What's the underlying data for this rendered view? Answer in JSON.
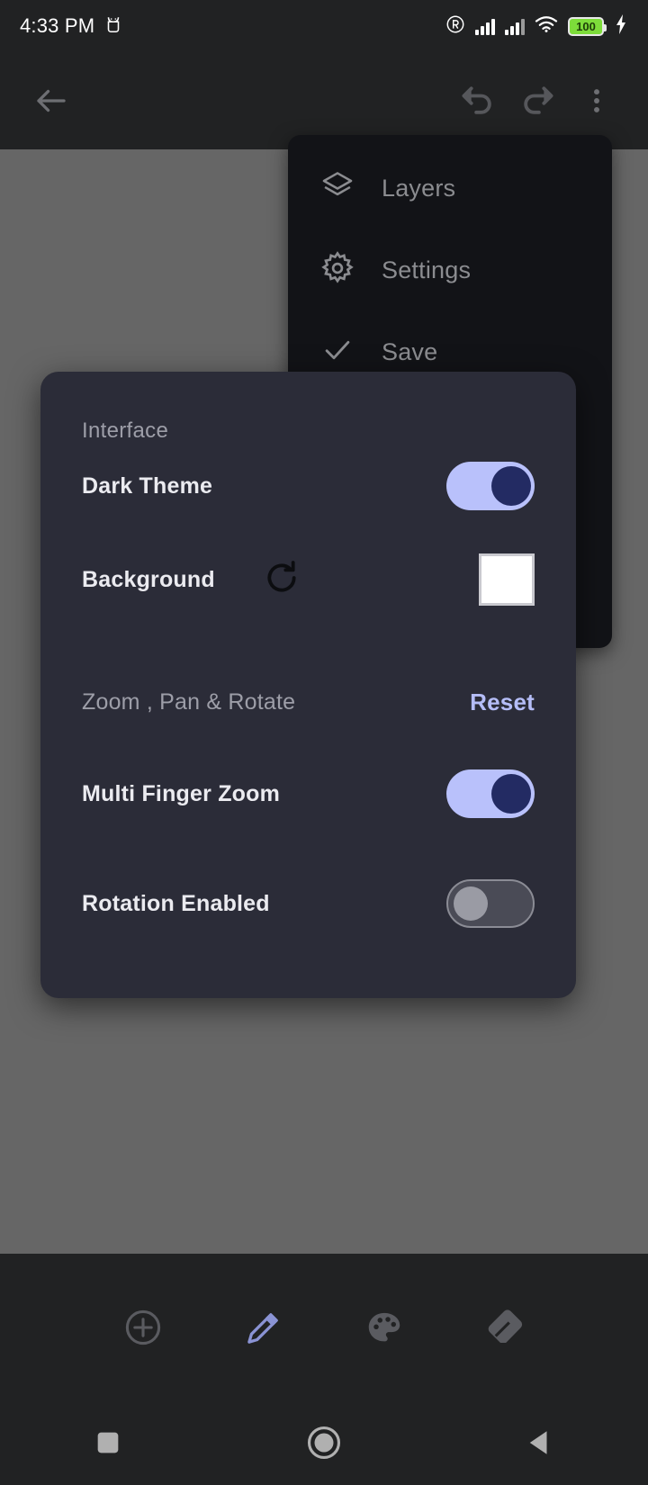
{
  "status_bar": {
    "time": "4:33 PM",
    "battery_level": "100",
    "icons": [
      "android-robot-icon",
      "registered-trademark-icon",
      "signal-bars-icon",
      "signal-bars-icon",
      "wifi-icon",
      "battery-icon",
      "charging-bolt-icon"
    ],
    "battery_color": "#7ddc3a"
  },
  "app_bar": {
    "back_label": "Back",
    "undo_label": "Undo",
    "redo_label": "Redo",
    "overflow_label": "More options"
  },
  "overflow_menu": {
    "items": [
      {
        "label": "Layers",
        "icon": "layers-icon"
      },
      {
        "label": "Settings",
        "icon": "gear-icon"
      },
      {
        "label": "Save",
        "icon": "check-icon"
      }
    ]
  },
  "settings_dialog": {
    "section_interface": "Interface",
    "dark_theme": {
      "label": "Dark Theme",
      "state": "on"
    },
    "background": {
      "label": "Background",
      "reset_icon": "refresh-icon",
      "swatch_color": "#ffffff"
    },
    "section_zoom": "Zoom , Pan & Rotate",
    "reset_label": "Reset",
    "multi_finger_zoom": {
      "label": "Multi Finger Zoom",
      "state": "on"
    },
    "rotation_enabled": {
      "label": "Rotation Enabled",
      "state": "off"
    },
    "accent_color": "#b9c1fb",
    "surface_color": "#2b2c38"
  },
  "bottom_toolbar": {
    "tools": [
      {
        "name": "add-layer-tool",
        "icon": "plus-circle-icon",
        "selected": false
      },
      {
        "name": "pencil-tool",
        "icon": "pencil-icon",
        "selected": true
      },
      {
        "name": "palette-tool",
        "icon": "palette-icon",
        "selected": false
      },
      {
        "name": "eraser-tool",
        "icon": "eraser-icon",
        "selected": false
      }
    ],
    "selected_color": "#8a93d4"
  },
  "nav_bar": {
    "recents_label": "Recents",
    "home_label": "Home",
    "back_label": "Back"
  }
}
